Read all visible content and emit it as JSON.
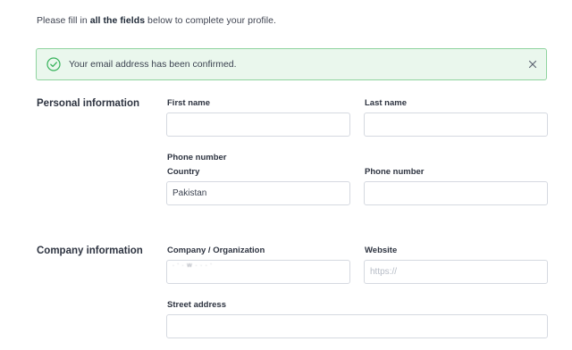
{
  "intro": {
    "prefix": "Please fill in ",
    "bold": "all the fields",
    "suffix": " below to complete your profile."
  },
  "alert": {
    "message": "Your email address has been confirmed.",
    "icon": "check-circle-icon",
    "close_icon": "close-icon",
    "color_border": "#8fd49f",
    "color_bg": "#eaf7ed",
    "color_icon": "#36b25a"
  },
  "personal": {
    "title": "Personal information",
    "first_name_label": "First name",
    "first_name_value": "",
    "last_name_label": "Last name",
    "last_name_value": "",
    "phone_group_label": "Phone number",
    "country_label": "Country",
    "country_value": "Pakistan",
    "phone_label": "Phone number",
    "phone_value": ""
  },
  "company": {
    "title": "Company information",
    "org_label": "Company / Organization",
    "org_value": "· ' · W · · · '",
    "website_label": "Website",
    "website_placeholder": "https://",
    "website_value": "",
    "street_label": "Street address",
    "street_value": ""
  }
}
